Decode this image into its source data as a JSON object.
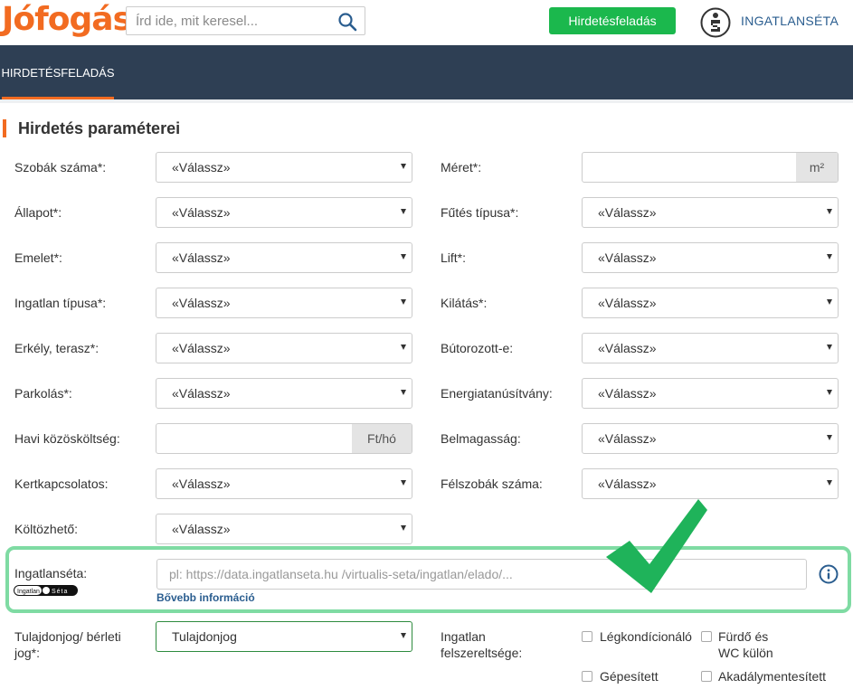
{
  "header": {
    "logo": "Jófogás",
    "search_placeholder": "Írd ide, mit keresel...",
    "post_button": "Hirdetésfeladás",
    "brand_label": "INGATLANSÉTA"
  },
  "nav": {
    "active_tab": "HIRDETÉSFELADÁS"
  },
  "section": {
    "title": "Hirdetés paraméterei"
  },
  "fields": {
    "szobak": {
      "label": "Szobák száma*:",
      "value": "«Válassz»"
    },
    "allapot": {
      "label": "Állapot*:",
      "value": "«Válassz»"
    },
    "emelet": {
      "label": "Emelet*:",
      "value": "«Válassz»"
    },
    "ingatlan_tipusa": {
      "label": "Ingatlan típusa*:",
      "value": "«Válassz»"
    },
    "erkely": {
      "label": "Erkély, terasz*:",
      "value": "«Válassz»"
    },
    "parkolas": {
      "label": "Parkolás*:",
      "value": "«Válassz»"
    },
    "kozoskoltseg": {
      "label": "Havi közösköltség:",
      "value": "",
      "unit": "Ft/hó"
    },
    "kertkapcsolatos": {
      "label": "Kertkapcsolatos:",
      "value": "«Válassz»"
    },
    "koltozheto": {
      "label": "Költözhető:",
      "value": "«Válassz»"
    },
    "meret": {
      "label": "Méret*:",
      "value": "",
      "unit": "m²"
    },
    "futes": {
      "label": "Fűtés típusa*:",
      "value": "«Válassz»"
    },
    "lift": {
      "label": "Lift*:",
      "value": "«Válassz»"
    },
    "kilatas": {
      "label": "Kilátás*:",
      "value": "«Válassz»"
    },
    "butorozott": {
      "label": "Bútorozott-e:",
      "value": "«Válassz»"
    },
    "energia": {
      "label": "Energiatanúsítvány:",
      "value": "«Válassz»"
    },
    "belmagassag": {
      "label": "Belmagasság:",
      "value": "«Válassz»"
    },
    "felszobak": {
      "label": "Félszobák száma:",
      "value": "«Válassz»"
    }
  },
  "ingatlanseta": {
    "label": "Ingatlanséta:",
    "logo_text": "Ingatlan Séta",
    "placeholder": "pl: https://data.ingatlanseta.hu /virtualis-seta/ingatlan/elado/...",
    "more_link": "Bővebb információ"
  },
  "tulajdonjog": {
    "label_line1": "Tulajdonjog/ bérleti",
    "label_line2": "jog*:",
    "value": "Tulajdonjog"
  },
  "felszereltseg": {
    "label_line1": "Ingatlan",
    "label_line2": "felszereltsége:",
    "options": [
      "Légkondícionáló",
      "Fürdő és",
      "WC külön",
      "Gépesített",
      "Akadálymentesített"
    ]
  },
  "colors": {
    "brand_orange": "#f26b21",
    "green_button": "#1bb84d",
    "nav_bg": "#2e3f54",
    "highlight": "#7fdba3",
    "check_green": "#1fb35a"
  }
}
